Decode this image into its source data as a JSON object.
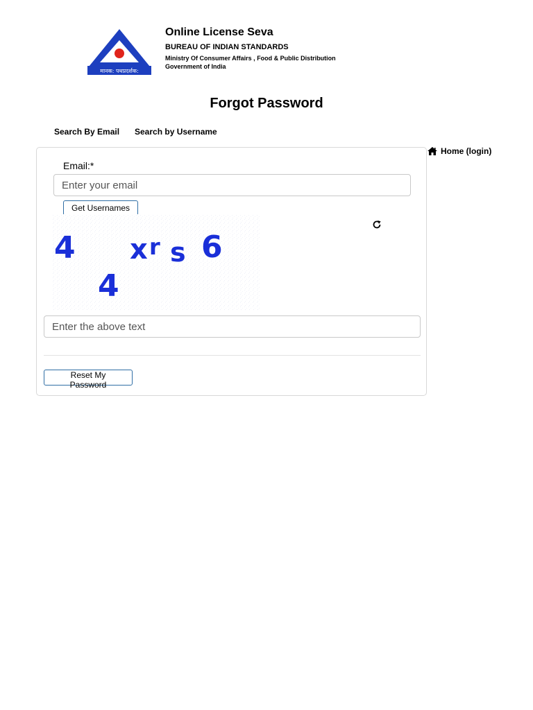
{
  "header": {
    "logo_icon": "bis-logo-icon",
    "logo_text": "मानक: पथप्रदर्शक:",
    "title": "Online License Seva",
    "organization": "BUREAU OF INDIAN STANDARDS",
    "ministry": "Ministry Of Consumer Affairs , Food & Public Distribution",
    "government": "Government of India"
  },
  "page": {
    "title": "Forgot Password"
  },
  "tabs": [
    {
      "label": "Search By Email"
    },
    {
      "label": "Search by Username"
    }
  ],
  "home_link": {
    "icon": "home-icon",
    "label": "Home (login)"
  },
  "form": {
    "email_label": "Email:*",
    "email_placeholder": "Enter your email",
    "get_usernames_label": "Get Usernames",
    "captcha_chars": [
      "4",
      "4",
      "x",
      "r",
      "s",
      "6"
    ],
    "refresh_icon": "refresh-icon",
    "captcha_placeholder": "Enter the above text",
    "reset_label": "Reset My Password"
  },
  "colors": {
    "logo_blue": "#1d3fbf",
    "logo_red": "#e0241b",
    "captcha_blue": "#1a2fd8",
    "button_border": "#2e6da4"
  }
}
